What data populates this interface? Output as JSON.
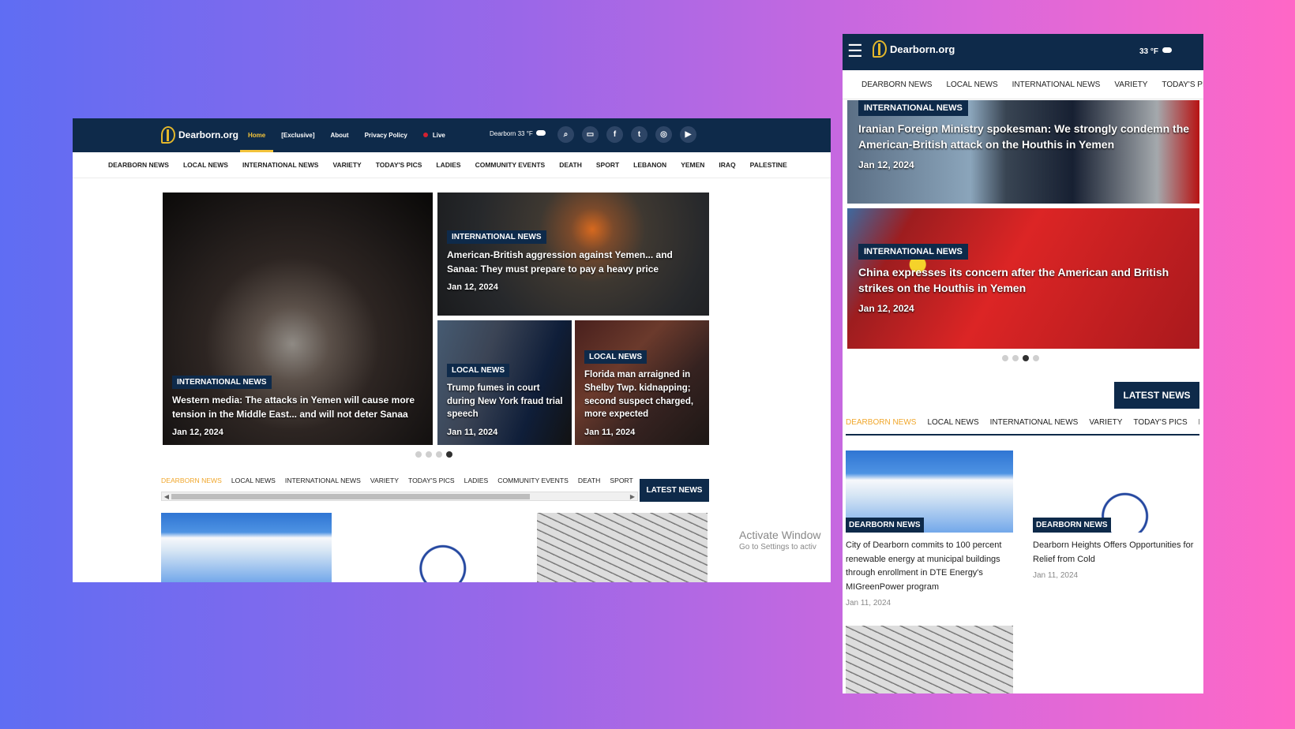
{
  "site": {
    "name": "Dearborn.org"
  },
  "desktop": {
    "nav": [
      "Home",
      "[Exclusive]",
      "About",
      "Privacy Policy",
      "Live"
    ],
    "weather": "Dearborn 33 °F",
    "categories": [
      "DEARBORN NEWS",
      "LOCAL NEWS",
      "INTERNATIONAL NEWS",
      "VARIETY",
      "TODAY'S PICS",
      "LADIES",
      "COMMUNITY EVENTS",
      "DEATH",
      "SPORT",
      "LEBANON",
      "YEMEN",
      "IRAQ",
      "PALESTINE"
    ],
    "hero_cards": [
      {
        "tag": "INTERNATIONAL NEWS",
        "title": "Western media: The attacks in Yemen will cause more tension in the Middle East... and will not deter Sanaa",
        "date": "Jan 12, 2024"
      },
      {
        "tag": "INTERNATIONAL NEWS",
        "title": "American-British aggression against Yemen... and Sanaa: They must prepare to pay a heavy price",
        "date": "Jan 12, 2024"
      },
      {
        "tag": "LOCAL NEWS",
        "title": "Trump fumes in court during New York fraud trial speech",
        "date": "Jan 11, 2024"
      },
      {
        "tag": "LOCAL NEWS",
        "title": "Florida man arraigned in Shelby Twp. kidnapping; second suspect charged, more expected",
        "date": "Jan 11, 2024"
      }
    ],
    "tabs": [
      "DEARBORN NEWS",
      "LOCAL NEWS",
      "INTERNATIONAL NEWS",
      "VARIETY",
      "TODAY'S PICS",
      "LADIES",
      "COMMUNITY EVENTS",
      "DEATH",
      "SPORT",
      "L"
    ],
    "latest_news": "LATEST NEWS"
  },
  "mobile": {
    "weather": "33 °F",
    "categories": [
      "DEARBORN NEWS",
      "LOCAL NEWS",
      "INTERNATIONAL NEWS",
      "VARIETY",
      "TODAY'S PI"
    ],
    "slides": [
      {
        "tag": "INTERNATIONAL NEWS",
        "title": "Iranian Foreign Ministry spokesman: We strongly condemn the American-British attack on the Houthis in Yemen",
        "date": "Jan 12, 2024"
      },
      {
        "tag": "INTERNATIONAL NEWS",
        "title": "China expresses its concern after the American and British strikes on the Houthis in Yemen",
        "date": "Jan 12, 2024"
      }
    ],
    "latest_news": "LATEST NEWS",
    "tabs": [
      "DEARBORN NEWS",
      "LOCAL NEWS",
      "INTERNATIONAL NEWS",
      "VARIETY",
      "TODAY'S PICS",
      "LA"
    ],
    "news": [
      {
        "tag": "DEARBORN NEWS",
        "title": "City of Dearborn commits to 100 percent renewable energy at municipal buildings through enrollment in DTE Energy's MIGreenPower program",
        "date": "Jan 11, 2024"
      },
      {
        "tag": "DEARBORN NEWS",
        "title": "Dearborn Heights Offers Opportunities for Relief from Cold",
        "date": "Jan 11, 2024"
      }
    ]
  },
  "overlay": {
    "activate_title": "Activate Window",
    "activate_sub": "Go to Settings to activ"
  },
  "colors": {
    "navy": "#0e2a4a",
    "accent": "#f3c33a",
    "live": "#d32030"
  }
}
